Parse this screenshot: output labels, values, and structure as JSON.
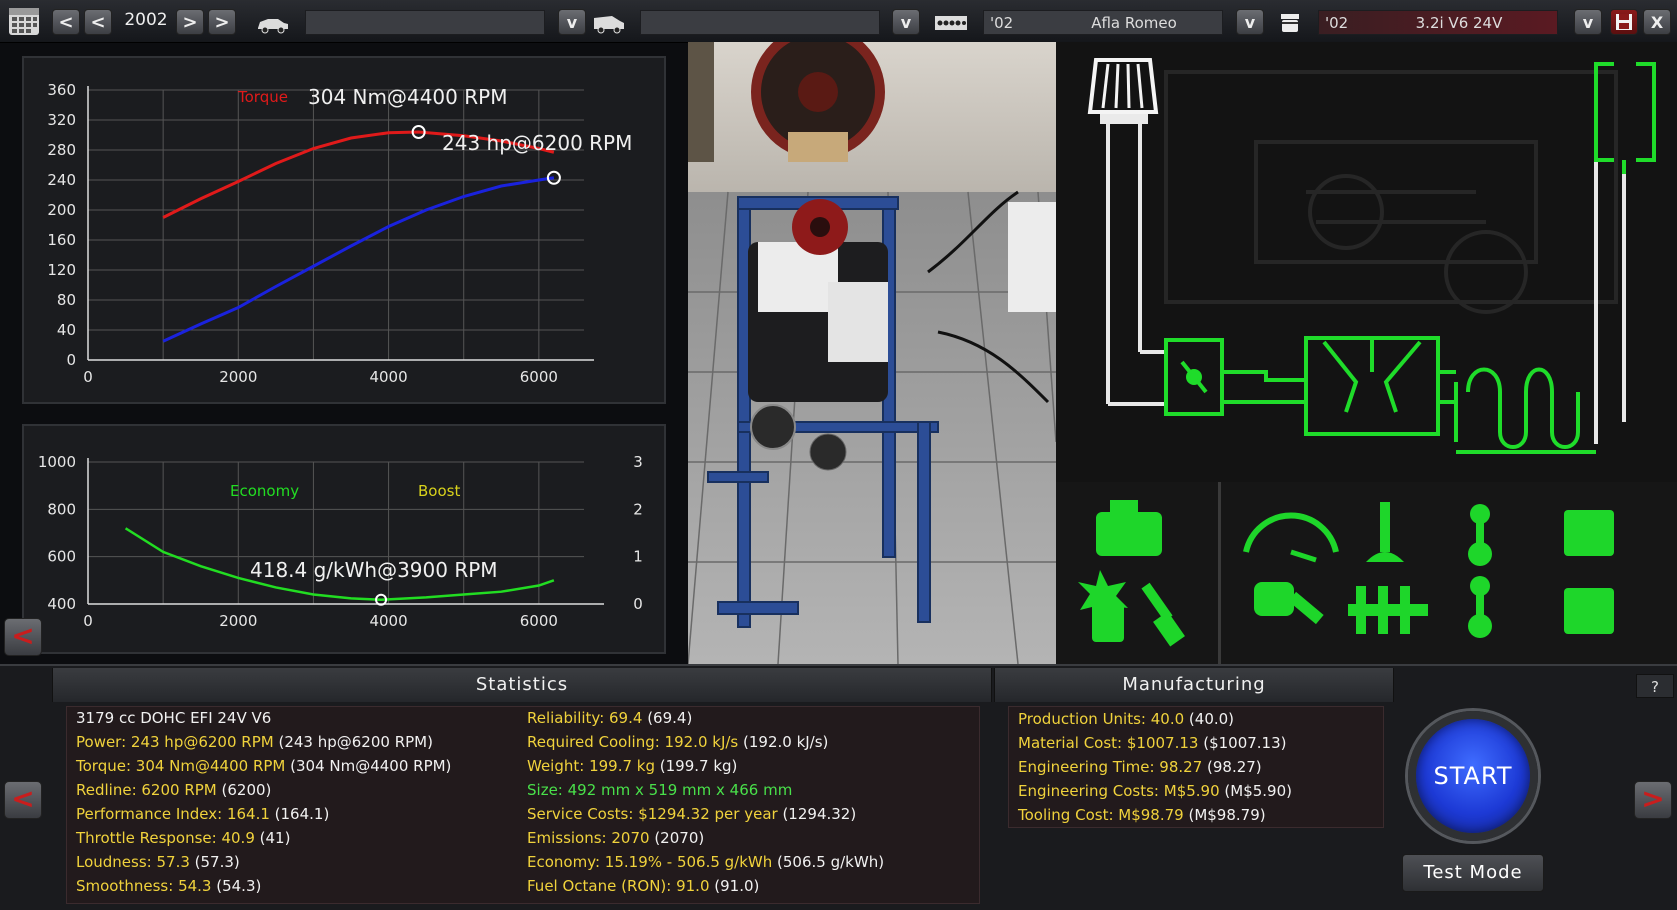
{
  "topbar": {
    "year": "2002",
    "prev_btn": "<",
    "next_btn": ">",
    "dropdown_btn": "v",
    "chassis_field": "",
    "model_field": "",
    "family_year": "'02",
    "family_name": "Afla Romeo",
    "variant_year": "'02",
    "variant_name": "3.2i V6 24V",
    "close_btn": "X"
  },
  "power_chart": {
    "series_label": "Torque",
    "torque_annotation": "304 Nm@4400 RPM",
    "power_annotation": "243 hp@6200 RPM",
    "colors": {
      "torque": "#e01a1a",
      "power": "#1a22dd"
    }
  },
  "economy_chart": {
    "economy_label": "Economy",
    "boost_label": "Boost",
    "annotation": "418.4 g/kWh@3900 RPM",
    "colors": {
      "economy": "#22dd22",
      "boost": "#d8d21c"
    }
  },
  "chart_data": [
    {
      "type": "line",
      "title": "",
      "xlabel": "",
      "ylabel": "",
      "xlim": [
        0,
        7000
      ],
      "ylim": [
        0,
        360
      ],
      "x_ticks": [
        0,
        2000,
        4000,
        6000
      ],
      "y_ticks": [
        0,
        40,
        80,
        120,
        160,
        200,
        240,
        280,
        320,
        360
      ],
      "grid": true,
      "series": [
        {
          "name": "Torque",
          "x": [
            1000,
            1500,
            2000,
            2500,
            3000,
            3500,
            4000,
            4400,
            5000,
            5500,
            6000,
            6200
          ],
          "values": [
            190,
            215,
            238,
            262,
            282,
            296,
            303,
            304,
            299,
            292,
            282,
            277
          ]
        },
        {
          "name": "",
          "x": [
            1000,
            1500,
            2000,
            2500,
            3000,
            3500,
            4000,
            4500,
            5000,
            5500,
            6000,
            6200
          ],
          "values": [
            25,
            48,
            70,
            98,
            125,
            152,
            178,
            200,
            218,
            232,
            240,
            243
          ]
        }
      ],
      "annotations": [
        "304 Nm@4400 RPM",
        "243 hp@6200 RPM"
      ]
    },
    {
      "type": "line",
      "title": "",
      "xlabel": "",
      "ylabel": "",
      "xlim": [
        0,
        7000
      ],
      "ylim": [
        400,
        1000
      ],
      "y2lim": [
        0,
        3
      ],
      "x_ticks": [
        0,
        2000,
        4000,
        6000
      ],
      "y_ticks": [
        400,
        600,
        800,
        1000
      ],
      "y2_ticks": [
        0,
        1,
        2,
        3
      ],
      "grid": true,
      "series": [
        {
          "name": "Economy",
          "x": [
            500,
            1000,
            1500,
            2000,
            2500,
            3000,
            3500,
            3900,
            4500,
            5000,
            5500,
            6000,
            6200
          ],
          "values": [
            720,
            620,
            560,
            510,
            470,
            440,
            424,
            418,
            428,
            440,
            452,
            478,
            500
          ]
        },
        {
          "name": "Boost",
          "x": [],
          "values": []
        }
      ],
      "annotations": [
        "418.4 g/kWh@3900 RPM"
      ]
    }
  ],
  "statistics": {
    "header": "Statistics",
    "left": [
      {
        "key": "",
        "value": "3179 cc DOHC EFI 24V V6"
      },
      {
        "key": "Power: 243 hp@6200 RPM",
        "value": " (243 hp@6200 RPM)"
      },
      {
        "key": "Torque: 304 Nm@4400 RPM",
        "value": " (304 Nm@4400 RPM)"
      },
      {
        "key": "Redline: 6200 RPM",
        "value": " (6200)"
      },
      {
        "key": "Performance Index: 164.1",
        "value": " (164.1)"
      },
      {
        "key": "Throttle Response: 40.9",
        "value": " (41)"
      },
      {
        "key": "Loudness: 57.3",
        "value": " (57.3)"
      },
      {
        "key": "Smoothness: 54.3",
        "value": " (54.3)"
      }
    ],
    "right": [
      {
        "key": "Reliability: 69.4",
        "value": " (69.4)",
        "green": false
      },
      {
        "key": "Required Cooling: 192.0 kJ/s",
        "value": " (192.0 kJ/s)",
        "green": false
      },
      {
        "key": "Weight: 199.7 kg",
        "value": " (199.7 kg)",
        "green": false
      },
      {
        "key": "Size: 492 mm x 519 mm x 466 mm",
        "value": "",
        "green": true
      },
      {
        "key": "Service Costs: $1294.32 per year",
        "value": " (1294.32)",
        "green": false
      },
      {
        "key": "Emissions: 2070",
        "value": " (2070)",
        "green": false
      },
      {
        "key": "Economy: 15.19% - 506.5 g/kWh",
        "value": " (506.5 g/kWh)",
        "green": false
      },
      {
        "key": "Fuel Octane (RON): 91.0",
        "value": " (91.0)",
        "green": false
      }
    ]
  },
  "manufacturing": {
    "header": "Manufacturing",
    "lines": [
      {
        "key": "Production Units: 40.0",
        "value": " (40.0)"
      },
      {
        "key": "Material Cost: $1007.13",
        "value": " ($1007.13)"
      },
      {
        "key": "Engineering Time: 98.27",
        "value": " (98.27)"
      },
      {
        "key": "Engineering Costs: M$5.90",
        "value": " (M$5.90)"
      },
      {
        "key": "Tooling Cost: M$98.79",
        "value": " (M$98.79)"
      }
    ]
  },
  "buttons": {
    "start": "START",
    "test_mode": "Test Mode",
    "help": "?",
    "back": "<",
    "forward": ">"
  }
}
